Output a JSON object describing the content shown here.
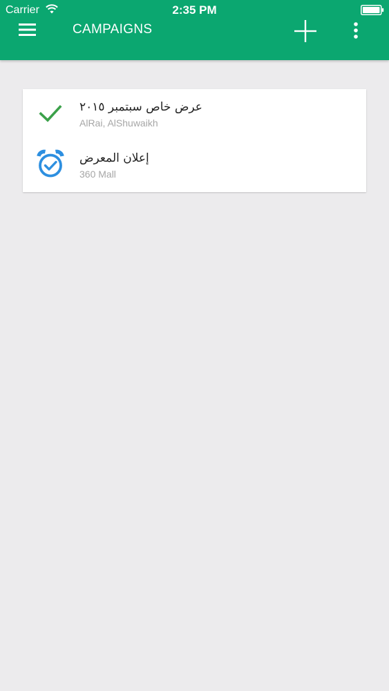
{
  "status_bar": {
    "carrier": "Carrier",
    "time": "2:35 PM"
  },
  "header": {
    "title": "CAMPAIGNS",
    "menu_icon": "hamburger-menu-icon",
    "add_icon": "plus-icon",
    "more_icon": "vertical-dots-icon",
    "background_color": "#0ba770"
  },
  "campaigns": [
    {
      "title": "عرض خاص سبتمبر ٢٠١٥",
      "location": "AlRai, AlShuwaikh",
      "status_icon": "check-icon",
      "status_color": "#3ba14a"
    },
    {
      "title": "إعلان المعرض",
      "location": "360 Mall",
      "status_icon": "alarm-clock-check-icon",
      "status_color": "#2d8fe0"
    }
  ]
}
